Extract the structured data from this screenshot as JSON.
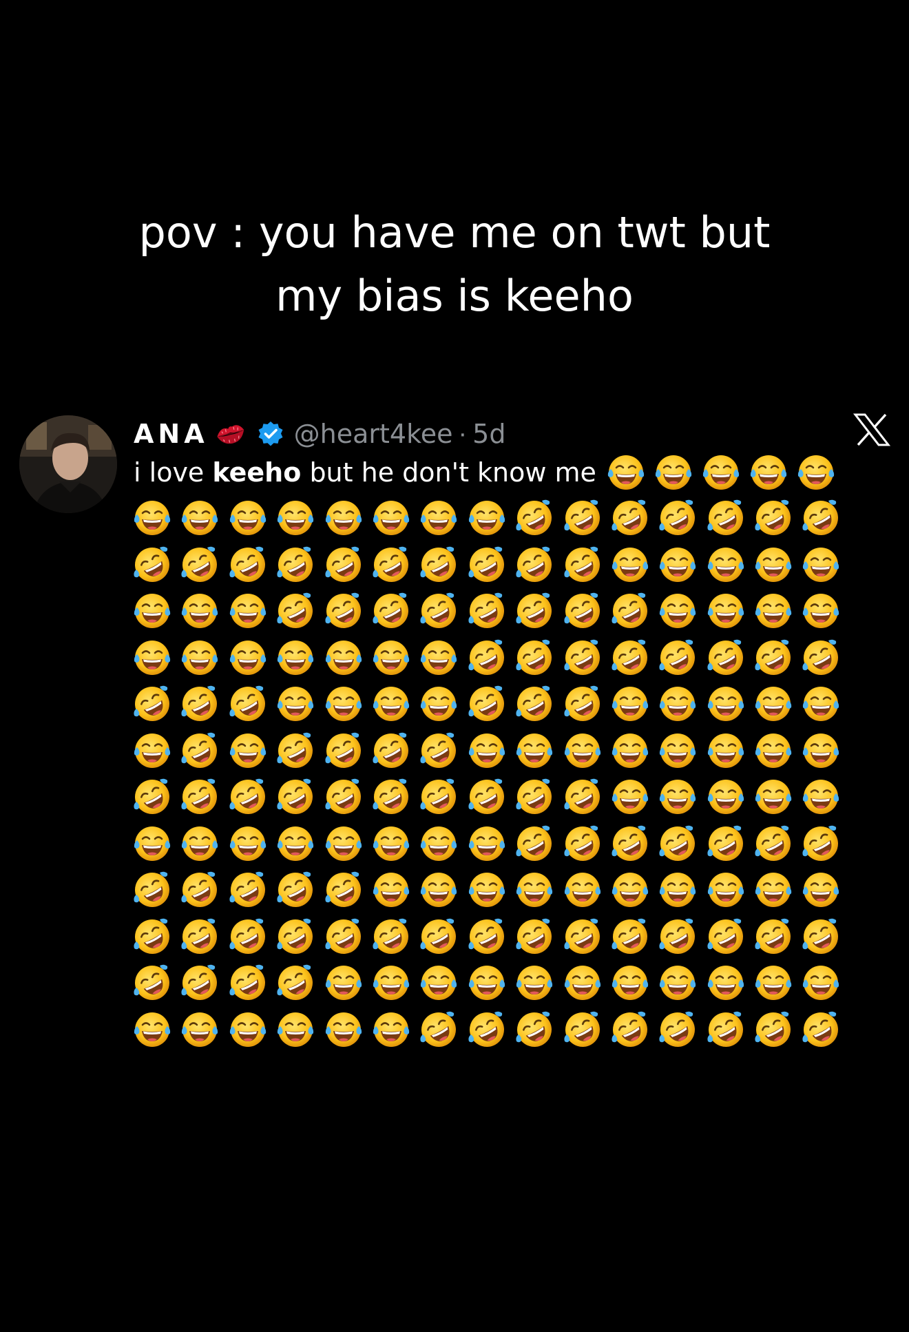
{
  "caption": {
    "line1": "pov : you have me on twt but",
    "line2": "my bias is keeho"
  },
  "tweet": {
    "display_name": "ANA",
    "name_emoji": "kiss-mark-icon",
    "verified_icon": "verified-badge-icon",
    "handle": "@heart4kee",
    "separator": "·",
    "time": "5d",
    "text_before": "i love ",
    "text_bold": "keeho",
    "text_after": " but he don't know me",
    "platform_icon": "x-logo-icon",
    "colors": {
      "background": "#000000",
      "text": "#ffffff",
      "muted": "#8b8f94",
      "verified": "#1d9bf0"
    },
    "inline_emojis": [
      "joy",
      "joy",
      "joy",
      "joy",
      "joy"
    ],
    "emoji_rows": [
      [
        "joy",
        "joy",
        "joy",
        "joy",
        "joy",
        "joy",
        "joy",
        "joy",
        "rofl",
        "rofl",
        "rofl",
        "rofl",
        "rofl",
        "rofl",
        "rofl"
      ],
      [
        "rofl",
        "rofl",
        "rofl",
        "rofl",
        "rofl",
        "rofl",
        "rofl",
        "rofl",
        "rofl",
        "rofl",
        "joy",
        "joy",
        "joy",
        "joy",
        "joy"
      ],
      [
        "joy",
        "joy",
        "joy",
        "rofl",
        "rofl",
        "rofl",
        "rofl",
        "rofl",
        "rofl",
        "rofl",
        "rofl",
        "joy",
        "joy",
        "joy",
        "joy"
      ],
      [
        "joy",
        "joy",
        "joy",
        "joy",
        "joy",
        "joy",
        "joy",
        "rofl",
        "rofl",
        "rofl",
        "rofl",
        "rofl",
        "rofl",
        "rofl",
        "rofl"
      ],
      [
        "rofl",
        "rofl",
        "rofl",
        "joy",
        "joy",
        "joy",
        "joy",
        "rofl",
        "rofl",
        "rofl",
        "joy",
        "joy",
        "joy",
        "joy",
        "joy"
      ],
      [
        "joy",
        "rofl",
        "joy",
        "rofl",
        "rofl",
        "rofl",
        "rofl",
        "joy",
        "joy",
        "joy",
        "joy",
        "joy",
        "joy",
        "joy",
        "joy"
      ],
      [
        "rofl",
        "rofl",
        "rofl",
        "rofl",
        "rofl",
        "rofl",
        "rofl",
        "rofl",
        "rofl",
        "rofl",
        "joy",
        "joy",
        "joy",
        "joy",
        "joy"
      ],
      [
        "joy",
        "joy",
        "joy",
        "joy",
        "joy",
        "joy",
        "joy",
        "joy",
        "rofl",
        "rofl",
        "rofl",
        "rofl",
        "rofl",
        "rofl",
        "rofl"
      ],
      [
        "rofl",
        "rofl",
        "rofl",
        "rofl",
        "rofl",
        "joy",
        "joy",
        "joy",
        "joy",
        "joy",
        "joy",
        "joy",
        "joy",
        "joy",
        "joy"
      ],
      [
        "rofl",
        "rofl",
        "rofl",
        "rofl",
        "rofl",
        "rofl",
        "rofl",
        "rofl",
        "rofl",
        "rofl",
        "rofl",
        "rofl",
        "rofl",
        "rofl",
        "rofl"
      ],
      [
        "rofl",
        "rofl",
        "rofl",
        "rofl",
        "joy",
        "joy",
        "joy",
        "joy",
        "joy",
        "joy",
        "joy",
        "joy",
        "joy",
        "joy",
        "joy"
      ],
      [
        "joy",
        "joy",
        "joy",
        "joy",
        "joy",
        "joy",
        "rofl",
        "rofl",
        "rofl",
        "rofl",
        "rofl",
        "rofl",
        "rofl",
        "rofl",
        "rofl"
      ]
    ]
  }
}
